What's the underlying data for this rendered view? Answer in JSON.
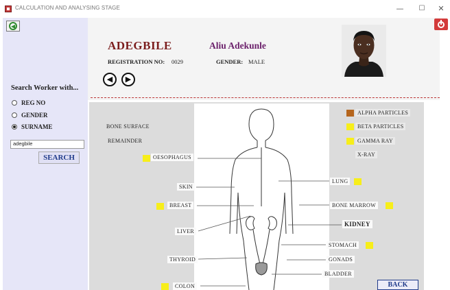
{
  "window": {
    "title": "CALCULATION AND ANALYSING STAGE",
    "minimize": "—",
    "maximize": "☐",
    "close": "✕"
  },
  "worker": {
    "surname": "ADEGBILE",
    "full_name": "Aliu Adekunle",
    "registration_label": "REGISTRATION NO:",
    "registration_no": "0029",
    "gender_label": "GENDER:",
    "gender": "MALE"
  },
  "nav": {
    "prev": "◀",
    "next": "▶"
  },
  "search": {
    "heading": "Search Worker with...",
    "options": [
      {
        "label": "REG NO",
        "selected": false
      },
      {
        "label": "GENDER",
        "selected": false
      },
      {
        "label": "SURNAME",
        "selected": true
      }
    ],
    "input_value": "adegbile",
    "button_label": "SEARCH"
  },
  "organs": {
    "bone_surface": "BONE SURFACE",
    "remainder": "REMAINDER",
    "oesophagus": "OESOPHAGUS",
    "skin": "SKIN",
    "breast": "BREAST",
    "liver": "LIVER",
    "thyroid": "THYROID",
    "colon": "COLON",
    "lung": "LUNG",
    "bone_marrow": "BONE MARROW",
    "kidney": "KIDNEY",
    "stomach": "STOMACH",
    "gonads": "GONADS",
    "bladder": "BLADDER"
  },
  "legend": [
    {
      "label": "ALPHA PARTICLES",
      "color": "#b5651d"
    },
    {
      "label": "BETA PARTICLES",
      "color": "#f7ee1a"
    },
    {
      "label": "GAMMA RAY",
      "color": "#f7ee1a"
    },
    {
      "label": "X-RAY",
      "color": ""
    }
  ],
  "actions": {
    "back_label": "BACK"
  },
  "colors": {
    "sidebar_bg": "#e6e6f8",
    "marker_yellow": "#f7ee1a",
    "marker_brown": "#b5651d",
    "surname_color": "#7b1d1d",
    "name_color": "#6a1f6a"
  }
}
